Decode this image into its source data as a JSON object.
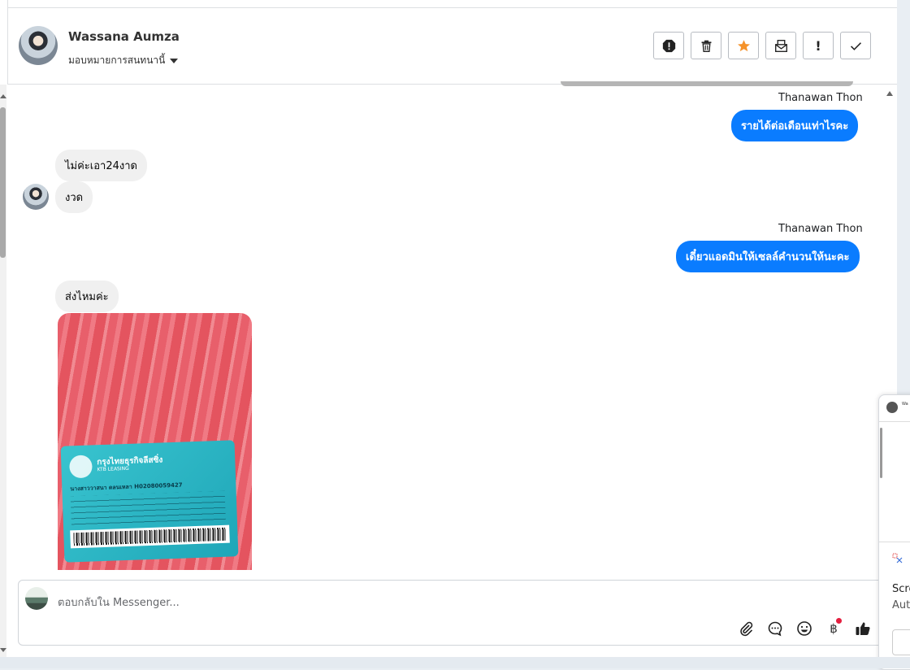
{
  "header": {
    "contact_name": "Wassana Aumza",
    "assign_label": "มอบหมายการสนทนานี้",
    "actions": [
      {
        "name": "spam-icon"
      },
      {
        "name": "trash-icon"
      },
      {
        "name": "star-icon",
        "color": "#f5922a"
      },
      {
        "name": "mark-unread-icon"
      },
      {
        "name": "important-icon",
        "glyph": "!"
      },
      {
        "name": "done-icon"
      }
    ]
  },
  "messages": {
    "sender1": "Thanawan Thon",
    "out1": "รายได้ต่อเดือนเท่าไรคะ",
    "in1": "ไม่ค่ะเอา24งาด",
    "in2": "งวด",
    "sender2": "Thanawan Thon",
    "out2": "เดี๋ยวแอดมินให้เซลล์คำนวนให้นะคะ",
    "in3": "ส่งไหมค่ะ"
  },
  "photo_card": {
    "bank": "กรุงไทยธุรกิจลีสซิ่ง",
    "bank_sub": "KTB LEASING",
    "holder_line": "นางสาววาสนา ดลนเหลา H02080059427"
  },
  "composer": {
    "placeholder": "ตอบกลับใน Messenger...",
    "tools": [
      "attach-icon",
      "saved-reply-icon",
      "emoji-icon",
      "baht-icon",
      "like-icon"
    ]
  },
  "side_panel": {
    "mini_name": "Wa",
    "text1": "Scre",
    "text2": "Aut"
  },
  "colors": {
    "accent": "#0a7cff",
    "star": "#f5922a",
    "notification": "#e41e3f"
  }
}
